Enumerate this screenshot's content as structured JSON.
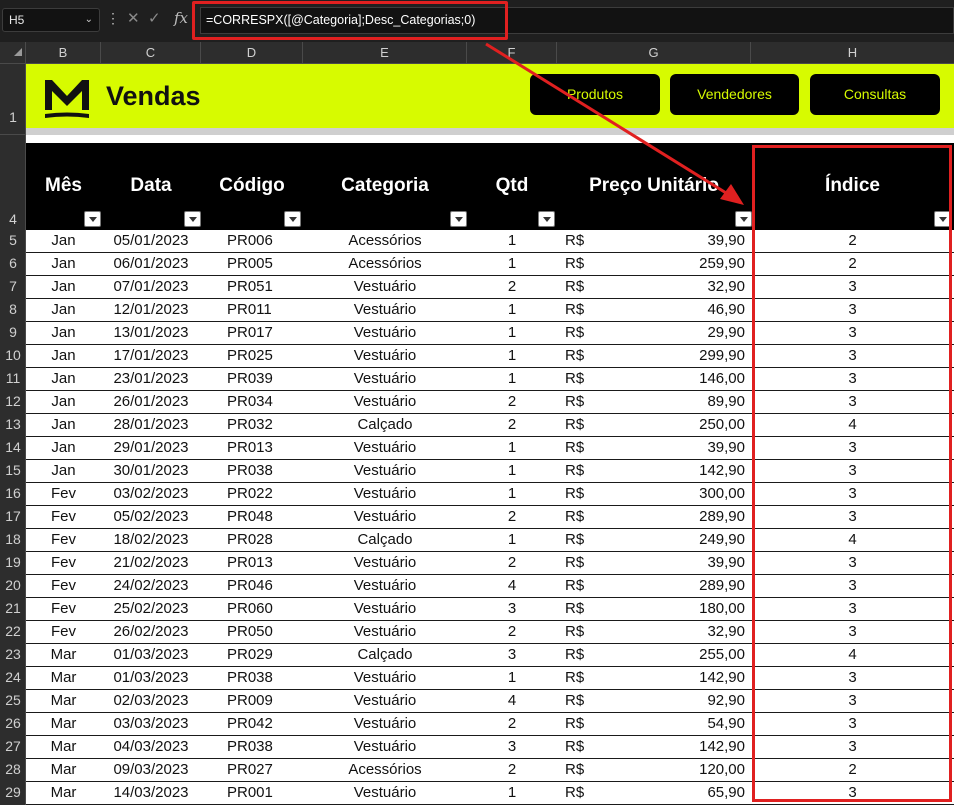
{
  "formula_bar": {
    "name_box": "H5",
    "chevron": "⌄",
    "dots": "⋮",
    "cancel_icon": "✕",
    "enter_icon": "✓",
    "fx_label": "fx",
    "formula": "=CORRESPX([@Categoria];Desc_Categorias;0)"
  },
  "columns": [
    "B",
    "C",
    "D",
    "E",
    "F",
    "G",
    "H"
  ],
  "row_headers": {
    "banner": "1",
    "header": "4",
    "data": [
      "5",
      "6",
      "7",
      "8",
      "9",
      "10",
      "11",
      "12",
      "13",
      "14",
      "15",
      "16",
      "17",
      "18",
      "19",
      "20",
      "21",
      "22",
      "23",
      "24",
      "25",
      "26",
      "27",
      "28",
      "29"
    ]
  },
  "banner": {
    "title": "Vendas",
    "buttons": [
      "Produtos",
      "Vendedores",
      "Consultas"
    ],
    "accent_color": "#d7fb00"
  },
  "table": {
    "headers": [
      "Mês",
      "Data",
      "Código",
      "Categoria",
      "Qtd",
      "Preço Unitário",
      "Índice"
    ],
    "currency": "R$",
    "rows": [
      [
        "Jan",
        "05/01/2023",
        "PR006",
        "Acessórios",
        "1",
        "39,90",
        "2"
      ],
      [
        "Jan",
        "06/01/2023",
        "PR005",
        "Acessórios",
        "1",
        "259,90",
        "2"
      ],
      [
        "Jan",
        "07/01/2023",
        "PR051",
        "Vestuário",
        "2",
        "32,90",
        "3"
      ],
      [
        "Jan",
        "12/01/2023",
        "PR011",
        "Vestuário",
        "1",
        "46,90",
        "3"
      ],
      [
        "Jan",
        "13/01/2023",
        "PR017",
        "Vestuário",
        "1",
        "29,90",
        "3"
      ],
      [
        "Jan",
        "17/01/2023",
        "PR025",
        "Vestuário",
        "1",
        "299,90",
        "3"
      ],
      [
        "Jan",
        "23/01/2023",
        "PR039",
        "Vestuário",
        "1",
        "146,00",
        "3"
      ],
      [
        "Jan",
        "26/01/2023",
        "PR034",
        "Vestuário",
        "2",
        "89,90",
        "3"
      ],
      [
        "Jan",
        "28/01/2023",
        "PR032",
        "Calçado",
        "2",
        "250,00",
        "4"
      ],
      [
        "Jan",
        "29/01/2023",
        "PR013",
        "Vestuário",
        "1",
        "39,90",
        "3"
      ],
      [
        "Jan",
        "30/01/2023",
        "PR038",
        "Vestuário",
        "1",
        "142,90",
        "3"
      ],
      [
        "Fev",
        "03/02/2023",
        "PR022",
        "Vestuário",
        "1",
        "300,00",
        "3"
      ],
      [
        "Fev",
        "05/02/2023",
        "PR048",
        "Vestuário",
        "2",
        "289,90",
        "3"
      ],
      [
        "Fev",
        "18/02/2023",
        "PR028",
        "Calçado",
        "1",
        "249,90",
        "4"
      ],
      [
        "Fev",
        "21/02/2023",
        "PR013",
        "Vestuário",
        "2",
        "39,90",
        "3"
      ],
      [
        "Fev",
        "24/02/2023",
        "PR046",
        "Vestuário",
        "4",
        "289,90",
        "3"
      ],
      [
        "Fev",
        "25/02/2023",
        "PR060",
        "Vestuário",
        "3",
        "180,00",
        "3"
      ],
      [
        "Fev",
        "26/02/2023",
        "PR050",
        "Vestuário",
        "2",
        "32,90",
        "3"
      ],
      [
        "Mar",
        "01/03/2023",
        "PR029",
        "Calçado",
        "3",
        "255,00",
        "4"
      ],
      [
        "Mar",
        "01/03/2023",
        "PR038",
        "Vestuário",
        "1",
        "142,90",
        "3"
      ],
      [
        "Mar",
        "02/03/2023",
        "PR009",
        "Vestuário",
        "4",
        "92,90",
        "3"
      ],
      [
        "Mar",
        "03/03/2023",
        "PR042",
        "Vestuário",
        "2",
        "54,90",
        "3"
      ],
      [
        "Mar",
        "04/03/2023",
        "PR038",
        "Vestuário",
        "3",
        "142,90",
        "3"
      ],
      [
        "Mar",
        "09/03/2023",
        "PR027",
        "Acessórios",
        "2",
        "120,00",
        "2"
      ],
      [
        "Mar",
        "14/03/2023",
        "PR001",
        "Vestuário",
        "1",
        "65,90",
        "3"
      ]
    ]
  },
  "annotation_color": "#e02020"
}
